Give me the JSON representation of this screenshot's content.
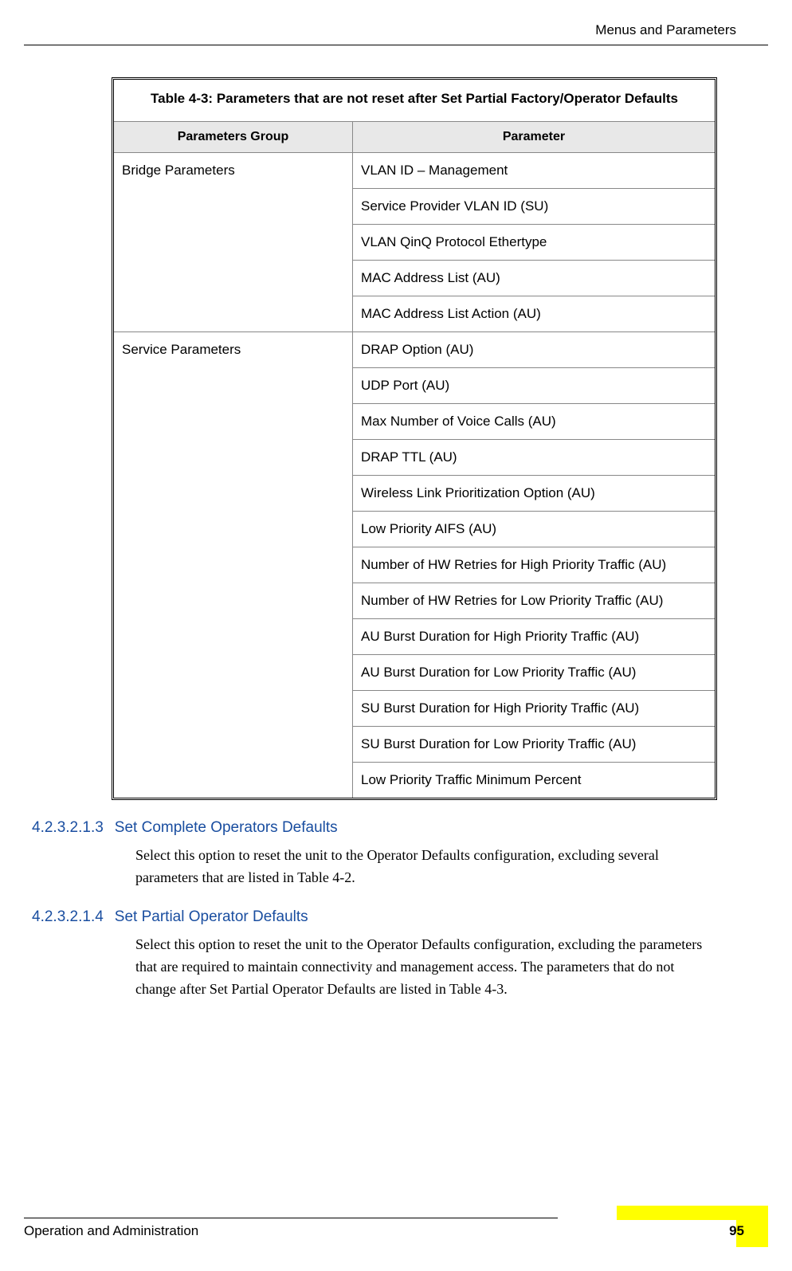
{
  "header": {
    "breadcrumb": "Menus and Parameters"
  },
  "table": {
    "caption": "Table 4-3: Parameters that are not reset after Set Partial Factory/Operator Defaults",
    "column_headers": {
      "group": "Parameters Group",
      "param": "Parameter"
    },
    "groups": [
      {
        "name": "Bridge Parameters",
        "params": [
          "VLAN ID – Management",
          "Service Provider VLAN ID (SU)",
          "VLAN QinQ Protocol Ethertype",
          "MAC Address List (AU)",
          "MAC Address List Action (AU)"
        ]
      },
      {
        "name": "Service Parameters",
        "params": [
          "DRAP Option (AU)",
          "UDP Port (AU)",
          "Max Number of Voice Calls (AU)",
          "DRAP TTL (AU)",
          "Wireless Link Prioritization Option (AU)",
          "Low Priority AIFS (AU)",
          "Number of HW Retries for High Priority Traffic (AU)",
          "Number of HW Retries for Low Priority Traffic (AU)",
          "AU Burst Duration for High Priority Traffic (AU)",
          "AU Burst Duration for Low Priority Traffic (AU)",
          "SU Burst Duration for High Priority Traffic (AU)",
          "SU Burst Duration for Low Priority Traffic (AU)",
          "Low Priority Traffic Minimum Percent"
        ]
      }
    ]
  },
  "sections": [
    {
      "number": "4.2.3.2.1.3",
      "title": "Set Complete Operators Defaults",
      "body": "Select this option to reset the unit to the Operator Defaults configuration, excluding several parameters that are listed in Table 4-2."
    },
    {
      "number": "4.2.3.2.1.4",
      "title": "Set Partial Operator Defaults",
      "body": "Select this option to reset the unit to the Operator Defaults configuration, excluding the parameters that are required to maintain connectivity and management access. The parameters that do not change after Set Partial Operator Defaults are listed in Table 4-3."
    }
  ],
  "footer": {
    "label": "Operation and Administration",
    "page": "95"
  }
}
